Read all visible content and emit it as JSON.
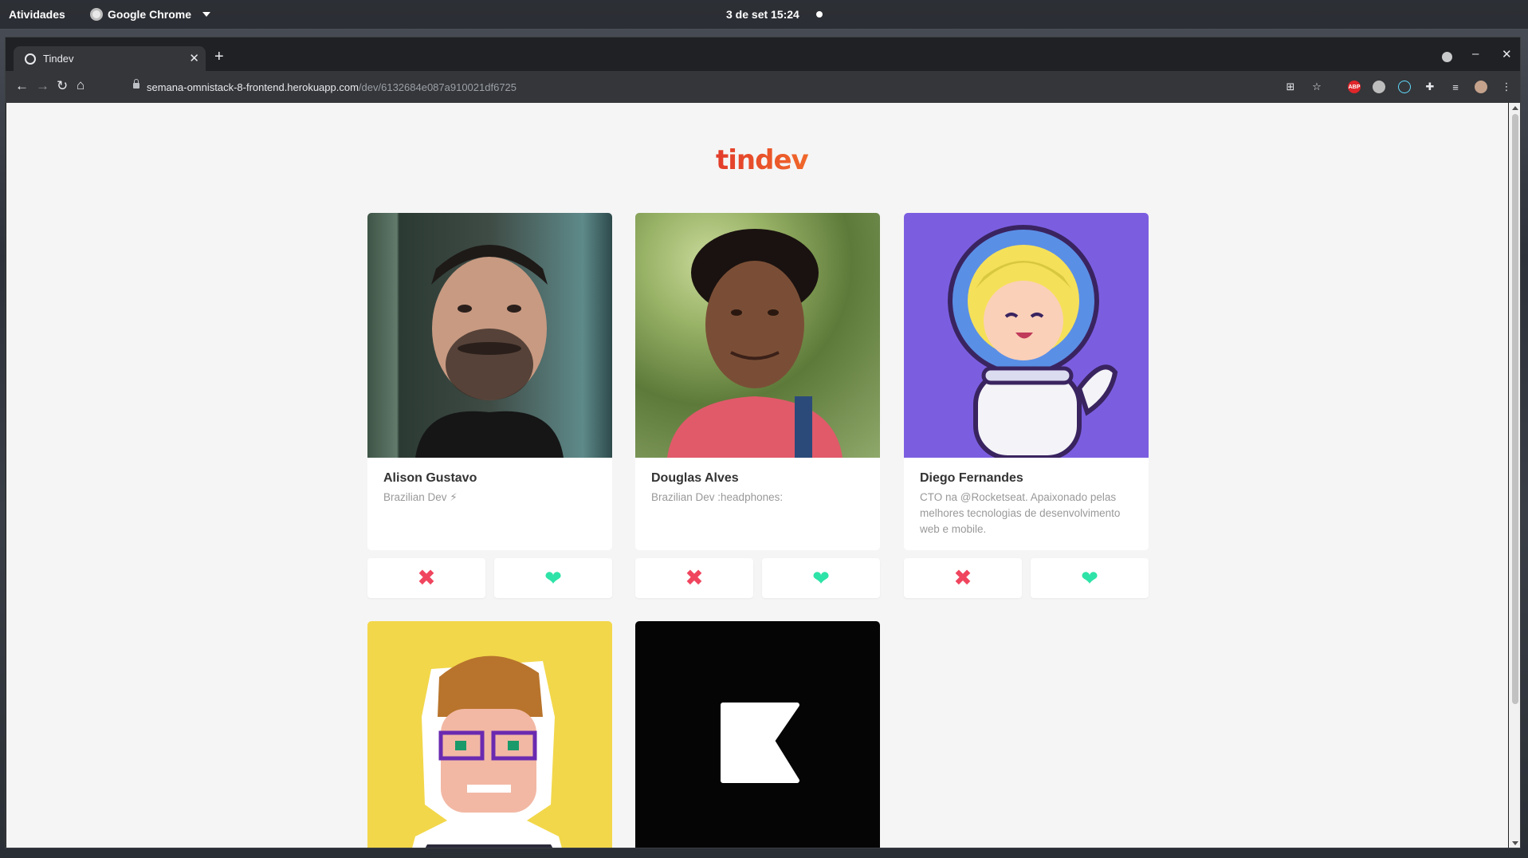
{
  "os_bar": {
    "activities": "Atividades",
    "app_name": "Google Chrome",
    "clock": "3 de set  15:24"
  },
  "browser": {
    "tab_title": "Tindev",
    "url_host": "semana-omnistack-8-frontend.herokuapp.com",
    "url_path": "/dev/6132684e087a910021df6725",
    "extensions": [
      "translate-icon",
      "star-icon",
      "adblock-icon",
      "mongodb-icon",
      "react-devtools-icon",
      "puzzle-icon",
      "media-icon",
      "profile-avatar",
      "menu-icon"
    ],
    "extension_labels": {
      "adblock": "ABP"
    }
  },
  "page": {
    "logo": "tindev",
    "colors": {
      "like": "#2ee3a7",
      "dislike": "#f0455e",
      "logo": "#e23c2b",
      "background": "#f5f5f5"
    },
    "users": [
      {
        "name": "Alison Gustavo",
        "bio": "Brazilian Dev ⚡"
      },
      {
        "name": "Douglas Alves",
        "bio": "Brazilian Dev :headphones:"
      },
      {
        "name": "Diego Fernandes",
        "bio": "CTO na @Rocketseat. Apaixonado pelas melhores tecnologias de desenvolvimento web e mobile."
      },
      {
        "name": "",
        "bio": ""
      },
      {
        "name": "",
        "bio": ""
      }
    ],
    "actions": {
      "dislike_icon": "x-icon",
      "like_icon": "heart-icon"
    }
  }
}
